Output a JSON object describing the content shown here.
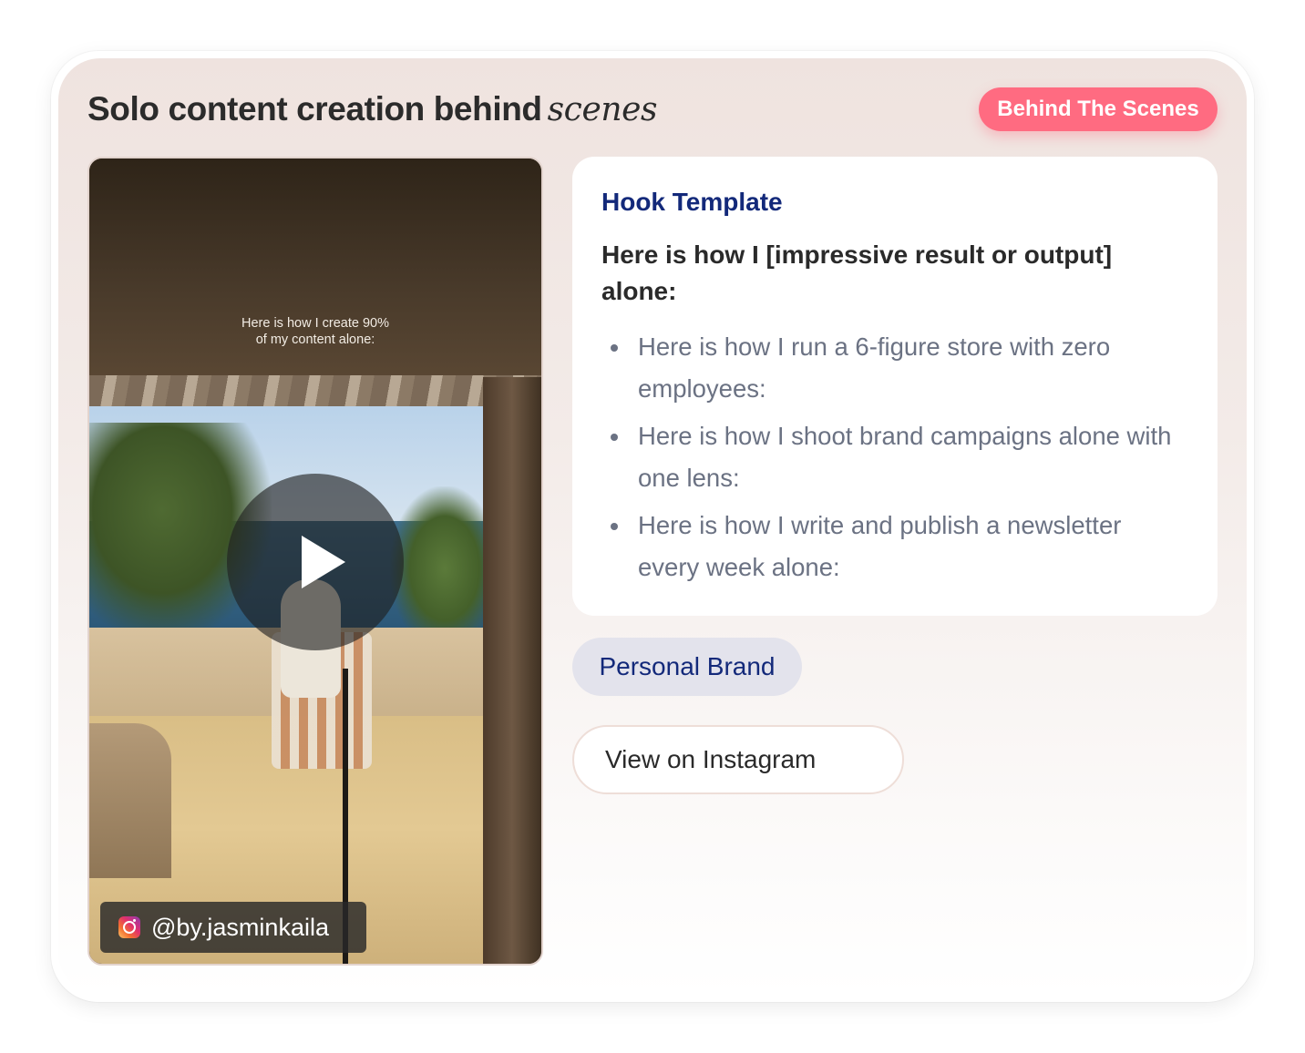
{
  "card": {
    "title_main": "Solo content creation behind",
    "title_emphasis": "scenes",
    "category_badge": "Behind The Scenes"
  },
  "video": {
    "overlay_text_line1": "Here is how I create 90%",
    "overlay_text_line2": "of my content alone:",
    "play_icon": "play-icon",
    "handle": "@by.jasminkaila",
    "handle_icon": "instagram-icon"
  },
  "hook": {
    "heading": "Hook Template",
    "template": "Here is how I [impressive result or output] alone:",
    "examples": [
      "Here is how I run a 6-figure store with zero employees:",
      "Here is how I shoot brand campaigns alone with one lens:",
      "Here is how I write and publish a newsletter every week alone:"
    ]
  },
  "tag": {
    "label": "Personal Brand"
  },
  "cta": {
    "label": "View on Instagram"
  },
  "colors": {
    "badge": "#ff6b81",
    "heading_blue": "#13297a",
    "tag_bg": "#e3e3ec",
    "muted_text": "#6b7283"
  }
}
